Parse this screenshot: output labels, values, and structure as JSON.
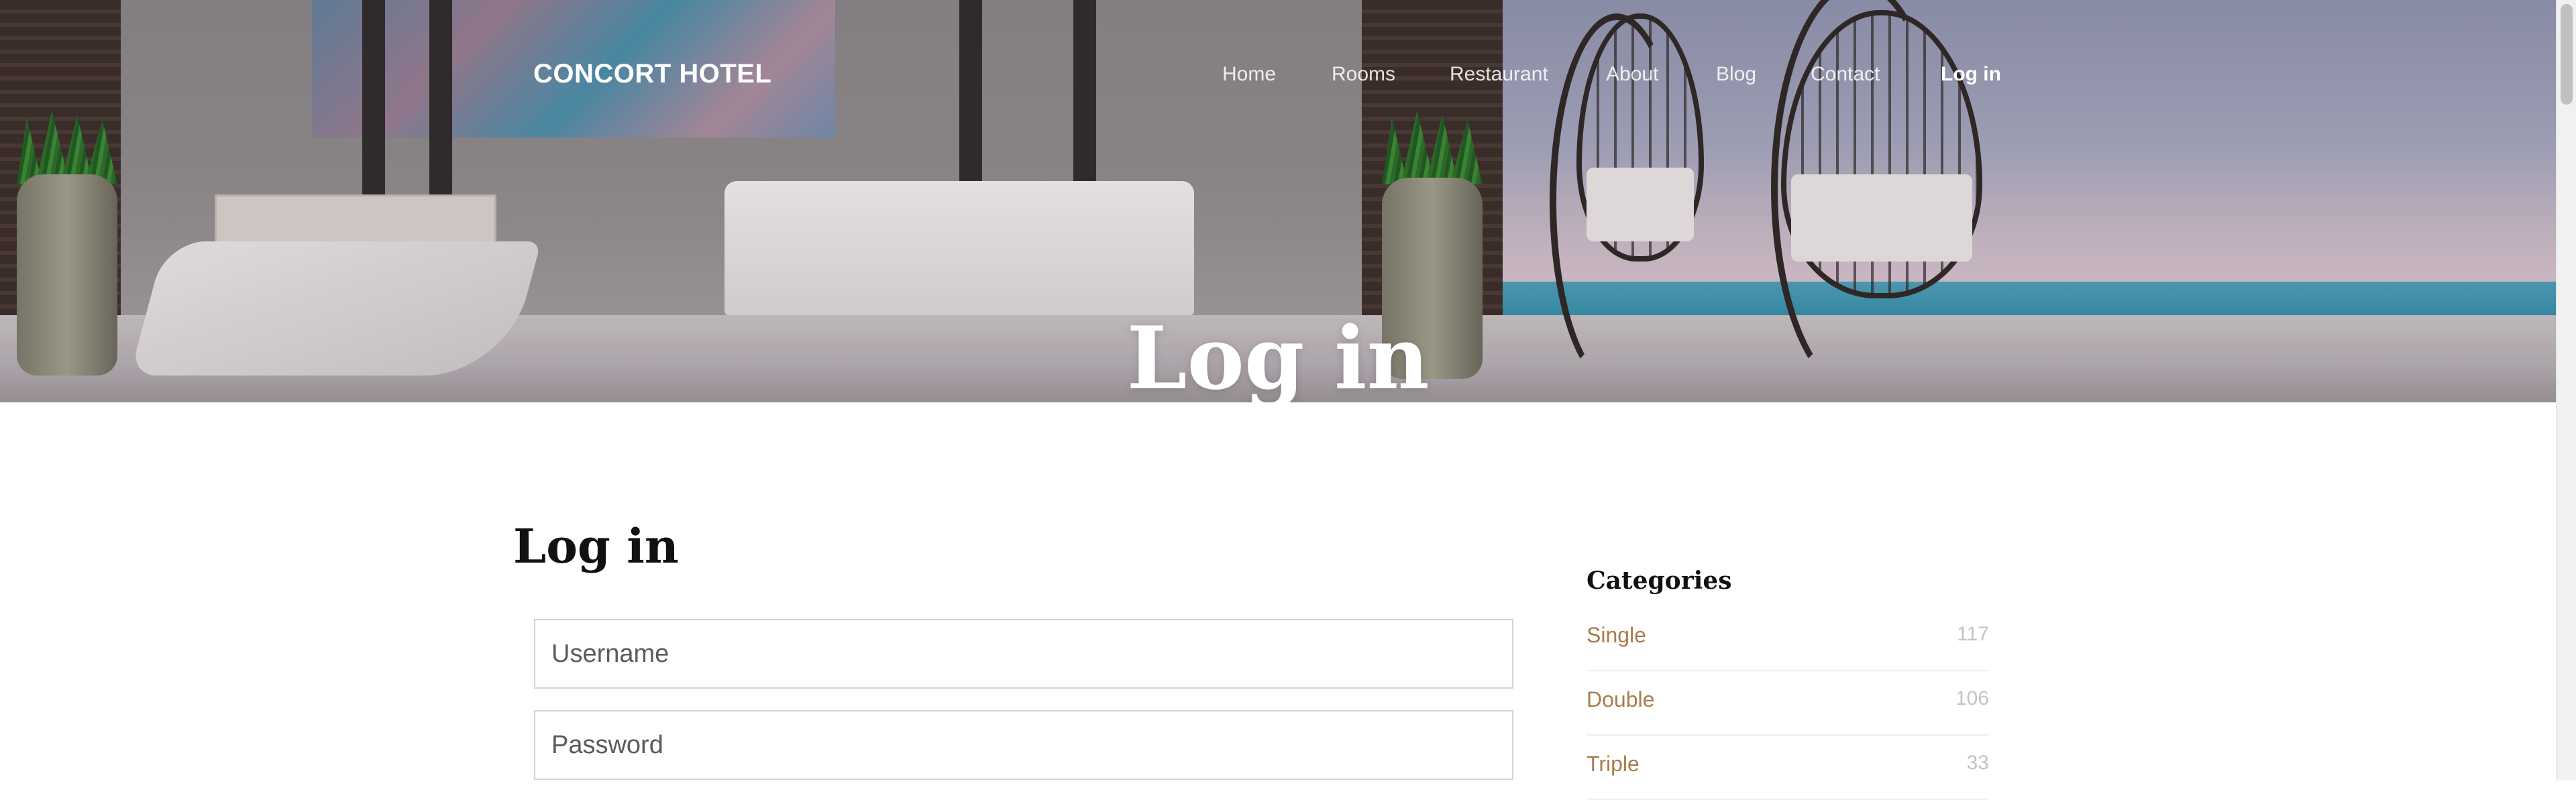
{
  "header": {
    "brand": "CONCORT HOTEL",
    "nav": [
      {
        "label": "Home",
        "active": false
      },
      {
        "label": "Rooms",
        "active": false
      },
      {
        "label": "Restaurant",
        "active": false
      },
      {
        "label": "About",
        "active": false
      },
      {
        "label": "Blog",
        "active": false
      },
      {
        "label": "Contact",
        "active": false
      },
      {
        "label": "Log in",
        "active": true
      }
    ]
  },
  "hero": {
    "title": "Log in"
  },
  "login_form": {
    "heading": "Log in",
    "username_placeholder": "Username",
    "password_placeholder": "Password"
  },
  "sidebar": {
    "title": "Categories",
    "categories": [
      {
        "name": "Single",
        "count": "117"
      },
      {
        "name": "Double",
        "count": "106"
      },
      {
        "name": "Triple",
        "count": "33"
      }
    ]
  },
  "colors": {
    "accent": "#a77d4a",
    "count": "#c4c4c4",
    "sea": "#2c8aa7"
  }
}
